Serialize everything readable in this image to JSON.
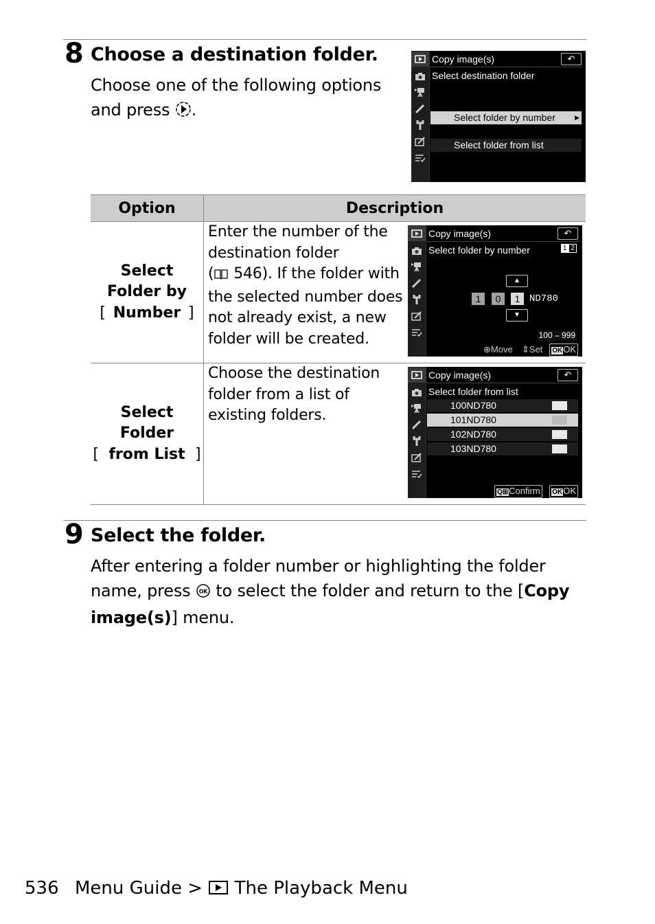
{
  "step8": {
    "number": "8",
    "title": "Choose a destination folder.",
    "instruction_line1": "Choose one of the following options",
    "instruction_line2_prefix": "and press",
    "instruction_icon": "multi-selector-right-icon",
    "instruction_line2_suffix": "."
  },
  "screen_destination": {
    "title": "Copy image(s)",
    "subtitle": "Select destination folder",
    "back_icon": "return-icon",
    "sidebar_icons": [
      "playback-icon",
      "camera-icon",
      "movie-icon",
      "pencil-icon",
      "wrench-icon",
      "retouch-icon",
      "my-menu-icon"
    ],
    "items": [
      {
        "label": "Select folder by number",
        "selected": true,
        "has_arrow": true
      },
      {
        "label": "Select folder from list",
        "selected": false,
        "has_arrow": false
      }
    ]
  },
  "table": {
    "headers": [
      "Option",
      "Description"
    ],
    "rows": [
      {
        "option_open": "[",
        "option_bold": "Select Folder by Number",
        "option_close": "]",
        "description_lines": [
          "Enter the number of the",
          "destination folder",
          "546). If the folder with",
          "the selected number does",
          "not already exist, a new",
          "folder will be created."
        ],
        "page_ref_icon": "book-icon",
        "page_ref": "546"
      },
      {
        "option_open": "[",
        "option_bold": "Select Folder from List",
        "option_close": "]",
        "description_lines": [
          "Choose the destination",
          "folder from a list of",
          "existing folders."
        ]
      }
    ]
  },
  "screen_by_number": {
    "title": "Copy image(s)",
    "subtitle": "Select folder by number",
    "card_slots": [
      "1",
      "2"
    ],
    "digits": [
      "1",
      "0",
      "1"
    ],
    "folder_suffix": "ND780",
    "range": "100 – 999",
    "footer_move": "Move",
    "footer_set": "Set",
    "footer_ok": "OK",
    "ok_badge": "OK"
  },
  "screen_from_list": {
    "title": "Copy image(s)",
    "subtitle": "Select folder from list",
    "folders": [
      {
        "name": "100ND780",
        "selected": false
      },
      {
        "name": "101ND780",
        "selected": true
      },
      {
        "name": "102ND780",
        "selected": false
      },
      {
        "name": "103ND780",
        "selected": false
      }
    ],
    "footer_confirm": "Confirm",
    "footer_ok": "OK",
    "ok_badge": "OK"
  },
  "step9": {
    "number": "9",
    "title": "Select the folder.",
    "line1": "After entering a folder number or highlighting the folder",
    "line2_prefix": "name, press",
    "line2_icon": "ok-button-icon",
    "line2_suffix": "to select the folder and return to the [",
    "line2_bold": "Copy",
    "line3_bold": "image(s)",
    "line3_suffix": "] menu."
  },
  "footer": {
    "page_number": "536",
    "breadcrumb_part1": "Menu Guide >",
    "breadcrumb_icon": "playback-menu-icon",
    "breadcrumb_part2": "The Playback Menu"
  }
}
